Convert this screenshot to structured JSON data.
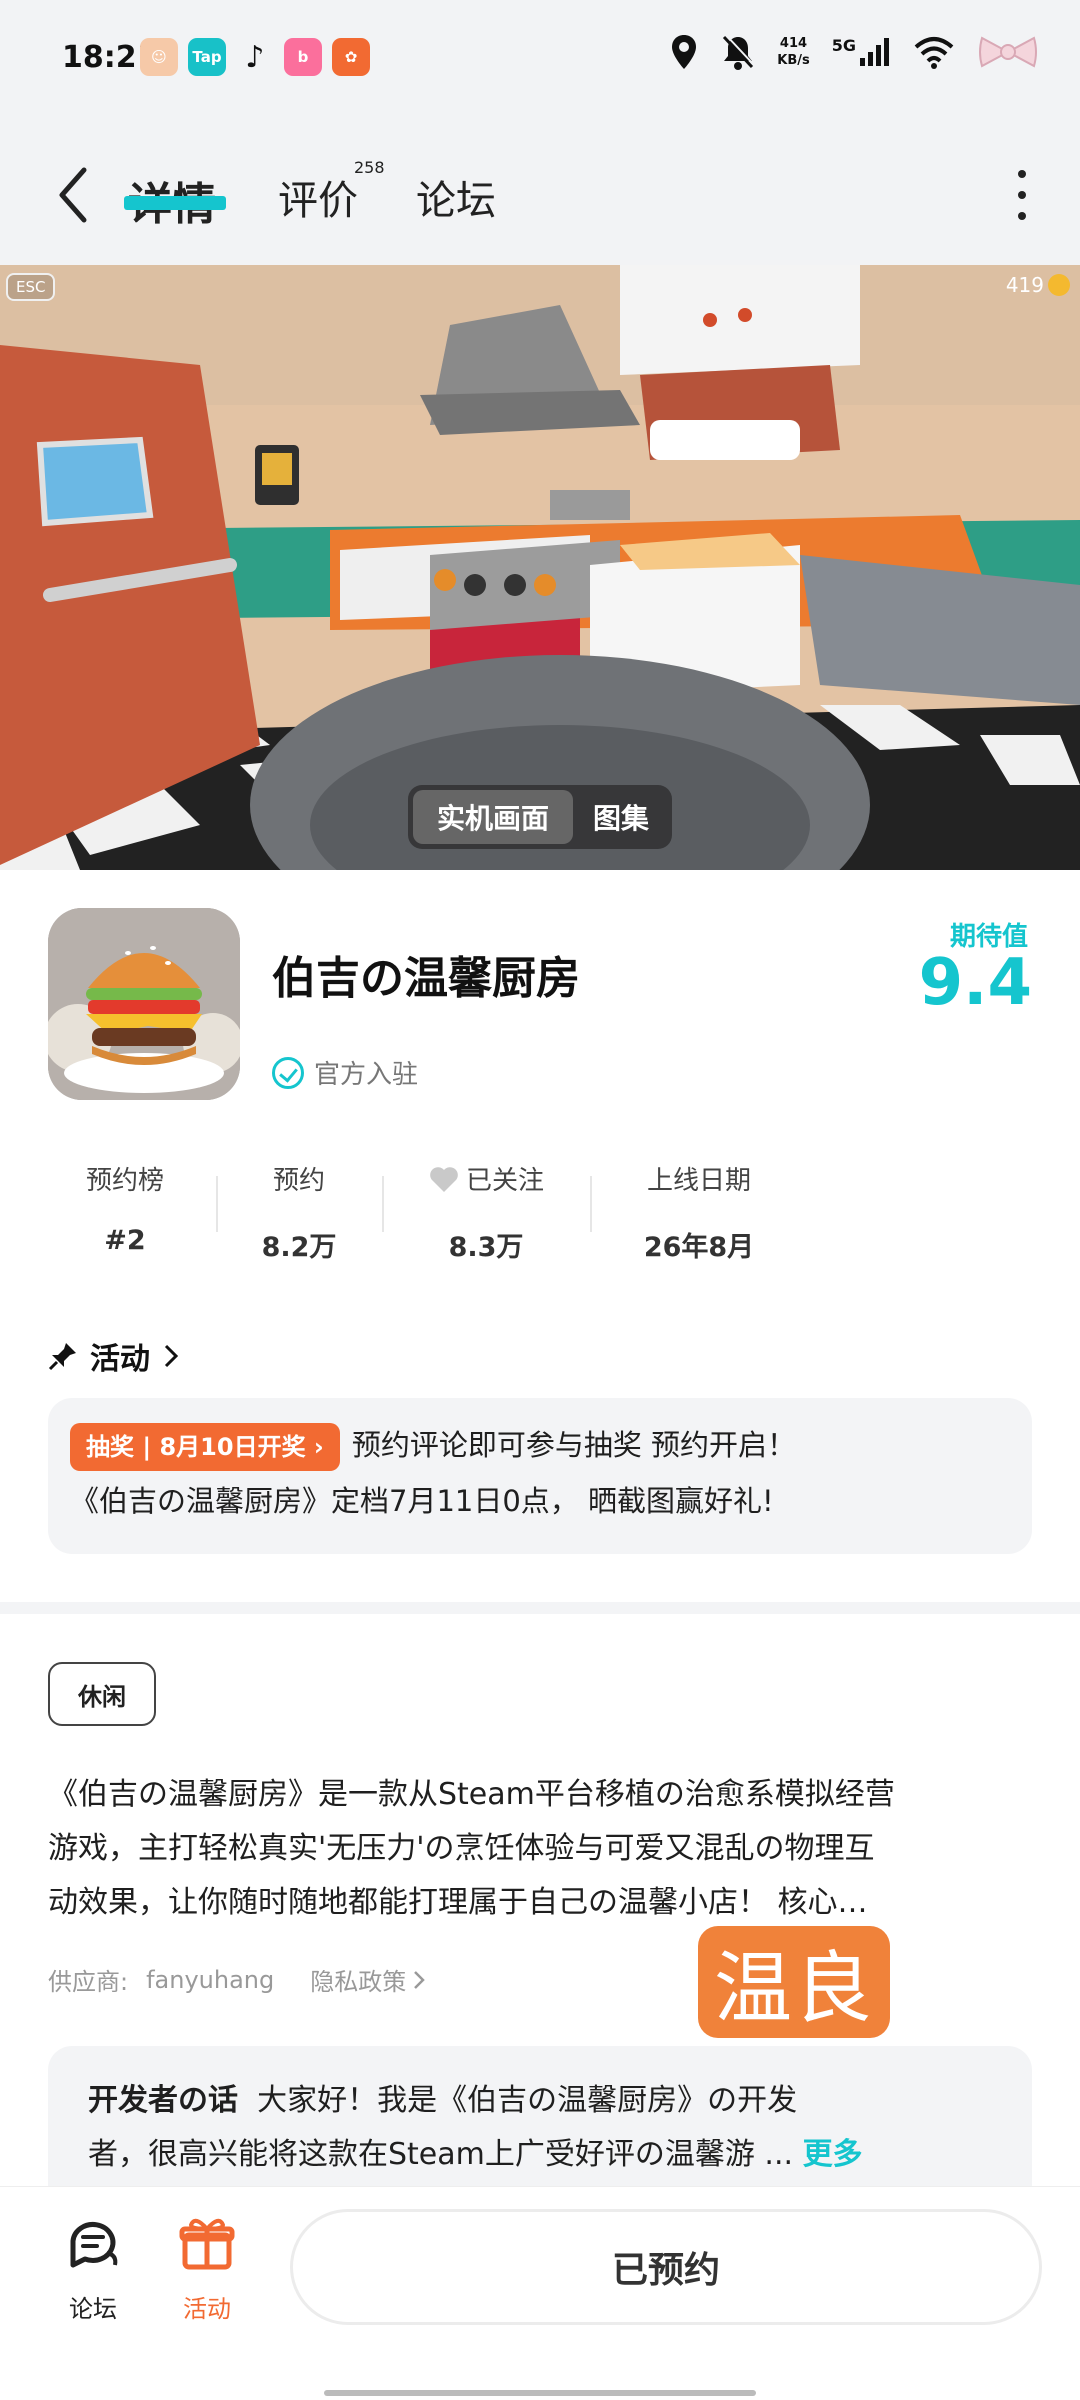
{
  "status_bar": {
    "time": "18:21",
    "speed": "414",
    "speed_unit": "KB/s",
    "network": "5G",
    "app_tap": "Tap"
  },
  "nav": {
    "tabs": [
      {
        "label": "详情"
      },
      {
        "label": "评价"
      },
      {
        "label": "论坛"
      }
    ],
    "review_count": "258"
  },
  "hero": {
    "esc": "ESC",
    "coins": "419",
    "toggle": [
      "实机画面",
      "图集"
    ]
  },
  "game": {
    "title": "伯吉の温馨厨房",
    "official": "官方入驻",
    "rating_label": "期待值",
    "rating_value": "9.4"
  },
  "stats": [
    {
      "label": "预约榜",
      "value": "#2"
    },
    {
      "label": "预约",
      "value": "8.2万"
    },
    {
      "label": "已关注",
      "value": "8.3万"
    },
    {
      "label": "上线日期",
      "value": "26年8月"
    }
  ],
  "activity": {
    "header": "活动",
    "tag": "抽奖 | 8月10日开奖",
    "text_1": "预约评论即可参与抽奖 预约开启！",
    "text_2": "《伯吉の温馨厨房》定档7月11日0点， 晒截图赢好礼!"
  },
  "genre": "休闲",
  "description": [
    "《伯吉の温馨厨房》是一款从Steam平台移植の治愈系模拟经营",
    "游戏，主打轻松真实'无压力'の烹饪体验与可爱又混乱の物理互",
    "动效果，让你随时随地都能打理属于自己の温馨小店！ 核心…"
  ],
  "supplier": {
    "label": "供应商:",
    "name": "fanyuhang",
    "privacy": "隐私政策"
  },
  "stamp": "温良",
  "developer": {
    "title": "开发者の话",
    "line_1": "大家好！我是《伯吉の温馨厨房》の开发",
    "line_2": "者，很高兴能将这款在Steam上广受好评の温馨游 ...",
    "more": "更多"
  },
  "bottom_bar": {
    "forum": "论坛",
    "activity": "活动",
    "reserve": "已预约"
  },
  "colors": {
    "accent": "#15c5ce",
    "orange": "#f26a32"
  }
}
